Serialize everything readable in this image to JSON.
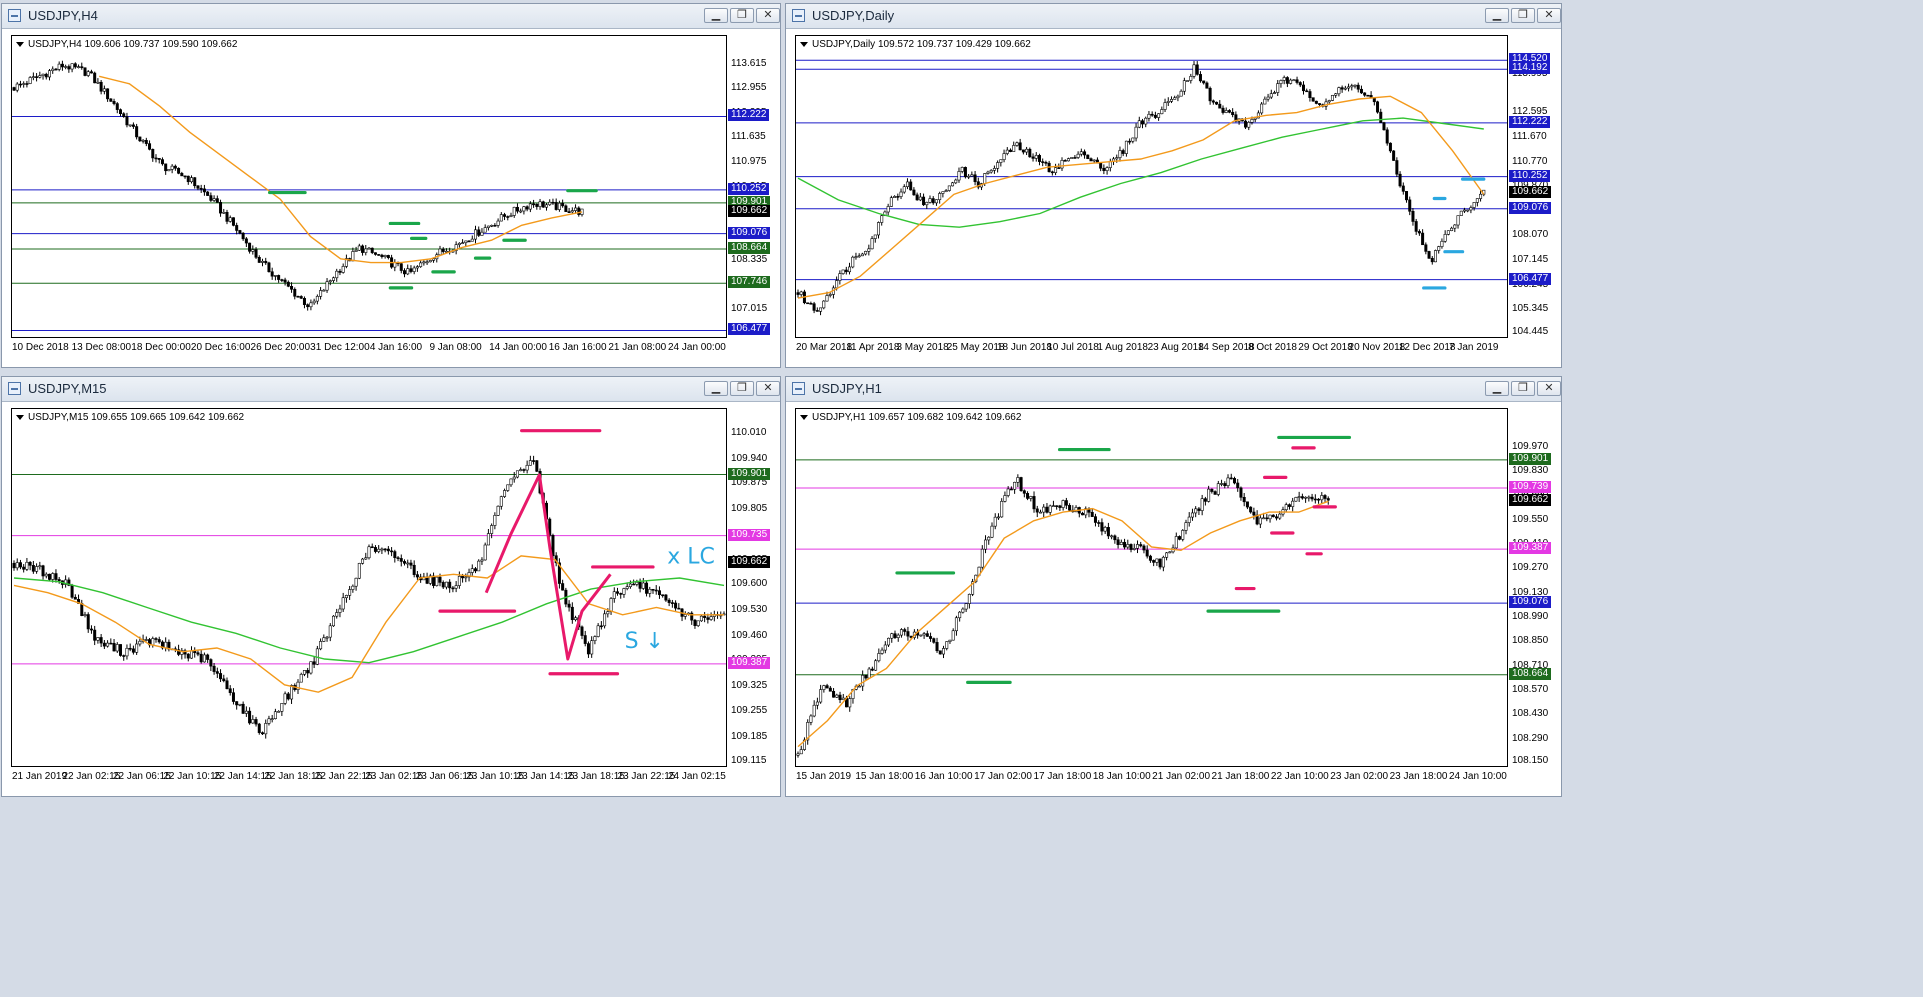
{
  "colors": {
    "candle": "#000000",
    "ma_fast": "#f39a1c",
    "ma_slow": "#32c332",
    "level_blue": "#1c1cc8",
    "level_green": "#1e6b1e",
    "level_magenta": "#e339e3",
    "mark_green": "#1aa64a",
    "mark_cyan": "#2aa7e0",
    "mark_pink": "#e8196a",
    "tag_current": "#000000",
    "window_bg": "#ffffff"
  },
  "icons": {
    "window": "chart-window-icon",
    "minimize": "minimize-icon",
    "restore": "restore-icon",
    "close": "close-icon"
  },
  "buttons": {
    "minimize": "▁",
    "restore": "❐",
    "close": "✕"
  },
  "windows": [
    {
      "id": "h4",
      "title": "USDJPY,H4",
      "info": "USDJPY,H4  109.606 109.737 109.590 109.662",
      "scale_labels": [
        "113.615",
        "112.955",
        "112.295",
        "111.635",
        "110.975",
        "110.315",
        "109.655",
        "108.995",
        "108.335",
        "107.675",
        "107.015",
        "106.355"
      ],
      "price_min": 106.355,
      "price_max": 113.9,
      "tags": [
        {
          "text": "112.222",
          "value": 112.222,
          "color": "#1c1cc8"
        },
        {
          "text": "110.252",
          "value": 110.252,
          "color": "#1c1cc8"
        },
        {
          "text": "109.901",
          "value": 109.901,
          "color": "#1e6b1e"
        },
        {
          "text": "109.662",
          "value": 109.662,
          "color": "#000000"
        },
        {
          "text": "109.076",
          "value": 109.076,
          "color": "#1c1cc8"
        },
        {
          "text": "108.664",
          "value": 108.664,
          "color": "#1e6b1e"
        },
        {
          "text": "107.746",
          "value": 107.746,
          "color": "#1e6b1e"
        },
        {
          "text": "106.477",
          "value": 106.477,
          "color": "#1c1cc8"
        }
      ],
      "time_labels": [
        "10 Dec 2018",
        "13 Dec 08:00",
        "18 Dec 00:00",
        "20 Dec 16:00",
        "26 Dec 20:00",
        "31 Dec 12:00",
        "4 Jan 16:00",
        "9 Jan 08:00",
        "14 Jan 00:00",
        "16 Jan 16:00",
        "21 Jan 08:00",
        "24 Jan 00:00"
      ],
      "series": [
        113.0,
        113.3,
        113.6,
        113.4,
        112.6,
        111.7,
        110.9,
        110.6,
        110.0,
        109.2,
        108.3,
        107.7,
        107.1,
        108.0,
        108.7,
        108.4,
        108.0,
        108.5,
        108.8,
        109.2,
        109.6,
        109.9,
        109.8,
        109.66
      ],
      "series_extent": 0.8,
      "ma_fast": [
        113.3,
        113.1,
        112.5,
        111.8,
        111.2,
        110.6,
        110.0,
        109.0,
        108.4,
        108.3,
        108.3,
        108.4,
        108.7,
        108.9,
        109.3,
        109.5,
        109.66
      ],
      "ma_fast_start": 0.12,
      "ma_slow": [],
      "marks": [
        {
          "color": "#1aa64a",
          "p": 110.18,
          "t0": 0.36,
          "t1": 0.41
        },
        {
          "color": "#1aa64a",
          "p": 110.23,
          "t0": 0.78,
          "t1": 0.82
        },
        {
          "color": "#1aa64a",
          "p": 109.35,
          "t0": 0.53,
          "t1": 0.57
        },
        {
          "color": "#1aa64a",
          "p": 108.9,
          "t0": 0.69,
          "t1": 0.72
        },
        {
          "color": "#1aa64a",
          "p": 108.95,
          "t0": 0.56,
          "t1": 0.58
        },
        {
          "color": "#1aa64a",
          "p": 108.42,
          "t0": 0.65,
          "t1": 0.67
        },
        {
          "color": "#1aa64a",
          "p": 108.05,
          "t0": 0.59,
          "t1": 0.62
        },
        {
          "color": "#1aa64a",
          "p": 107.62,
          "t0": 0.53,
          "t1": 0.56
        }
      ]
    },
    {
      "id": "daily",
      "title": "USDJPY,Daily",
      "info": "USDJPY,Daily  109.572 109.737 109.429 109.662",
      "scale_labels": [
        "114.520",
        "113.995",
        "112.595",
        "111.670",
        "110.770",
        "109.870",
        "108.970",
        "108.070",
        "107.145",
        "106.245",
        "105.345",
        "104.445"
      ],
      "price_min": 104.445,
      "price_max": 114.75,
      "tags": [
        {
          "text": "114.520",
          "value": 114.52,
          "color": "#1c1cc8"
        },
        {
          "text": "114.192",
          "value": 114.192,
          "color": "#1c1cc8"
        },
        {
          "text": "112.222",
          "value": 112.222,
          "color": "#1c1cc8"
        },
        {
          "text": "110.252",
          "value": 110.252,
          "color": "#1c1cc8"
        },
        {
          "text": "109.662",
          "value": 109.662,
          "color": "#000000"
        },
        {
          "text": "109.076",
          "value": 109.076,
          "color": "#1c1cc8"
        },
        {
          "text": "106.477",
          "value": 106.477,
          "color": "#1c1cc8"
        }
      ],
      "time_labels": [
        "20 Mar 2018",
        "11 Apr 2018",
        "3 May 2018",
        "25 May 2018",
        "18 Jun 2018",
        "10 Jul 2018",
        "1 Aug 2018",
        "23 Aug 2018",
        "14 Sep 2018",
        "8 Oct 2018",
        "29 Oct 2018",
        "20 Nov 2018",
        "12 Dec 2018",
        "7 Jan 2019"
      ],
      "series": [
        106.0,
        105.3,
        106.3,
        107.2,
        107.8,
        109.3,
        110.0,
        109.2,
        109.6,
        110.5,
        110.0,
        110.7,
        111.4,
        111.0,
        110.5,
        110.9,
        111.1,
        110.5,
        111.2,
        112.3,
        112.6,
        113.3,
        114.3,
        112.9,
        112.5,
        112.1,
        113.2,
        113.8,
        113.5,
        112.9,
        113.4,
        113.6,
        112.9,
        110.7,
        108.8,
        107.1,
        108.2,
        109.1,
        109.662
      ],
      "series_extent": 0.97,
      "ma_fast": [
        105.8,
        106.0,
        106.6,
        107.6,
        108.6,
        109.6,
        110.0,
        110.3,
        110.6,
        110.7,
        110.8,
        110.9,
        111.2,
        111.6,
        112.3,
        112.5,
        112.6,
        112.9,
        113.1,
        113.2,
        112.6,
        111.2,
        109.6
      ],
      "ma_fast_start": 0.0,
      "ma_slow": [
        110.2,
        109.4,
        108.9,
        108.5,
        108.4,
        108.6,
        108.9,
        109.5,
        110.0,
        110.4,
        110.9,
        111.3,
        111.7,
        112.0,
        112.3,
        112.4,
        112.2,
        112.0
      ],
      "ma_slow_start": 0.0,
      "marks": [
        {
          "color": "#2aa7e0",
          "p": 110.16,
          "t0": 0.94,
          "t1": 0.97
        },
        {
          "color": "#2aa7e0",
          "p": 109.45,
          "t0": 0.9,
          "t1": 0.915
        },
        {
          "color": "#2aa7e0",
          "p": 107.5,
          "t0": 0.915,
          "t1": 0.94
        },
        {
          "color": "#2aa7e0",
          "p": 106.17,
          "t0": 0.885,
          "t1": 0.915
        }
      ]
    },
    {
      "id": "m15",
      "title": "USDJPY,M15",
      "info": "USDJPY,M15  109.655 109.665 109.642 109.662",
      "scale_labels": [
        "110.010",
        "109.940",
        "109.875",
        "109.805",
        "109.735",
        "109.665",
        "109.600",
        "109.530",
        "109.460",
        "109.395",
        "109.325",
        "109.255",
        "109.185",
        "109.115"
      ],
      "price_min": 109.115,
      "price_max": 110.03,
      "tags": [
        {
          "text": "109.901",
          "value": 109.901,
          "color": "#1e6b1e"
        },
        {
          "text": "109.735",
          "value": 109.735,
          "color": "#e339e3"
        },
        {
          "text": "109.662",
          "value": 109.662,
          "color": "#000000"
        },
        {
          "text": "109.387",
          "value": 109.387,
          "color": "#e339e3"
        }
      ],
      "time_labels": [
        "21 Jan 2019",
        "22 Jan 02:15",
        "22 Jan 06:15",
        "22 Jan 10:15",
        "22 Jan 14:15",
        "22 Jan 18:15",
        "22 Jan 22:15",
        "23 Jan 02:15",
        "23 Jan 06:15",
        "23 Jan 10:15",
        "23 Jan 14:15",
        "23 Jan 18:15",
        "23 Jan 22:15",
        "24 Jan 02:15"
      ],
      "series": [
        109.66,
        109.64,
        109.6,
        109.45,
        109.42,
        109.45,
        109.42,
        109.4,
        109.3,
        109.2,
        109.3,
        109.4,
        109.55,
        109.7,
        109.68,
        109.62,
        109.6,
        109.65,
        109.86,
        109.95,
        109.6,
        109.42,
        109.58,
        109.6,
        109.55,
        109.5,
        109.52
      ],
      "series_extent": 1.0,
      "ma_fast": [
        109.6,
        109.58,
        109.55,
        109.5,
        109.44,
        109.42,
        109.43,
        109.4,
        109.33,
        109.31,
        109.35,
        109.5,
        109.62,
        109.63,
        109.62,
        109.68,
        109.67,
        109.55,
        109.52,
        109.54,
        109.52,
        109.52
      ],
      "ma_fast_start": 0.0,
      "ma_slow": [
        109.62,
        109.61,
        109.58,
        109.54,
        109.5,
        109.47,
        109.43,
        109.4,
        109.39,
        109.42,
        109.46,
        109.5,
        109.55,
        109.59,
        109.61,
        109.62,
        109.6
      ],
      "ma_slow_start": 0.0,
      "marks": [
        {
          "color": "#e8196a",
          "p": 110.02,
          "t0": 0.715,
          "t1": 0.825
        },
        {
          "color": "#e8196a",
          "p": 109.53,
          "t0": 0.6,
          "t1": 0.705
        },
        {
          "color": "#e8196a",
          "p": 109.65,
          "t0": 0.815,
          "t1": 0.9
        },
        {
          "color": "#e8196a",
          "p": 109.36,
          "t0": 0.755,
          "t1": 0.85
        }
      ],
      "pen_strokes": [
        {
          "color": "#e8196a",
          "points": [
            [
              0.665,
              109.58
            ],
            [
              0.7,
              109.74
            ],
            [
              0.74,
              109.9
            ],
            [
              0.755,
              109.7
            ],
            [
              0.78,
              109.4
            ],
            [
              0.8,
              109.53
            ],
            [
              0.84,
              109.63
            ]
          ]
        }
      ],
      "handwriting": [
        {
          "text": "x LC",
          "color": "#2aa7e0",
          "p": 109.66,
          "t": 0.92
        },
        {
          "text": "S ↓",
          "color": "#2aa7e0",
          "p": 109.43,
          "t": 0.86
        }
      ]
    },
    {
      "id": "h1",
      "title": "USDJPY,H1",
      "info": "USDJPY,H1  109.657 109.682 109.642 109.662",
      "scale_labels": [
        "109.970",
        "109.830",
        "109.690",
        "109.550",
        "109.410",
        "109.270",
        "109.130",
        "108.990",
        "108.850",
        "108.710",
        "108.570",
        "108.430",
        "108.290",
        "108.150"
      ],
      "price_min": 108.15,
      "price_max": 110.09,
      "tags": [
        {
          "text": "109.901",
          "value": 109.901,
          "color": "#1e6b1e"
        },
        {
          "text": "109.739",
          "value": 109.739,
          "color": "#e339e3"
        },
        {
          "text": "109.662",
          "value": 109.662,
          "color": "#000000"
        },
        {
          "text": "109.387",
          "value": 109.387,
          "color": "#e339e3"
        },
        {
          "text": "109.076",
          "value": 109.076,
          "color": "#1c1cc8"
        },
        {
          "text": "108.664",
          "value": 108.664,
          "color": "#1e6b1e"
        }
      ],
      "time_labels": [
        "15 Jan 2019",
        "15 Jan 18:00",
        "16 Jan 10:00",
        "17 Jan 02:00",
        "17 Jan 18:00",
        "18 Jan 10:00",
        "21 Jan 02:00",
        "21 Jan 18:00",
        "22 Jan 10:00",
        "23 Jan 02:00",
        "23 Jan 18:00",
        "24 Jan 10:00"
      ],
      "series": [
        108.2,
        108.6,
        108.5,
        108.7,
        108.9,
        108.9,
        108.8,
        109.1,
        109.5,
        109.8,
        109.6,
        109.65,
        109.6,
        109.45,
        109.4,
        109.3,
        109.5,
        109.7,
        109.8,
        109.55,
        109.6,
        109.7,
        109.662
      ],
      "series_extent": 0.75,
      "ma_fast": [
        108.25,
        108.4,
        108.6,
        108.7,
        108.9,
        109.05,
        109.2,
        109.45,
        109.55,
        109.6,
        109.62,
        109.55,
        109.4,
        109.38,
        109.48,
        109.55,
        109.6,
        109.6,
        109.662
      ],
      "ma_fast_start": 0.0,
      "ma_slow": [],
      "marks": [
        {
          "color": "#1aa64a",
          "p": 110.03,
          "t0": 0.68,
          "t1": 0.78
        },
        {
          "color": "#1aa64a",
          "p": 109.96,
          "t0": 0.37,
          "t1": 0.44
        },
        {
          "color": "#1aa64a",
          "p": 109.25,
          "t0": 0.14,
          "t1": 0.22
        },
        {
          "color": "#1aa64a",
          "p": 109.03,
          "t0": 0.58,
          "t1": 0.68
        },
        {
          "color": "#1aa64a",
          "p": 108.62,
          "t0": 0.24,
          "t1": 0.3
        },
        {
          "color": "#e8196a",
          "p": 109.8,
          "t0": 0.66,
          "t1": 0.69
        },
        {
          "color": "#e8196a",
          "p": 109.16,
          "t0": 0.62,
          "t1": 0.645
        },
        {
          "color": "#e8196a",
          "p": 109.97,
          "t0": 0.7,
          "t1": 0.73
        },
        {
          "color": "#e8196a",
          "p": 109.63,
          "t0": 0.73,
          "t1": 0.76
        },
        {
          "color": "#e8196a",
          "p": 109.36,
          "t0": 0.72,
          "t1": 0.74
        },
        {
          "color": "#e8196a",
          "p": 109.48,
          "t0": 0.67,
          "t1": 0.7
        }
      ]
    }
  ]
}
